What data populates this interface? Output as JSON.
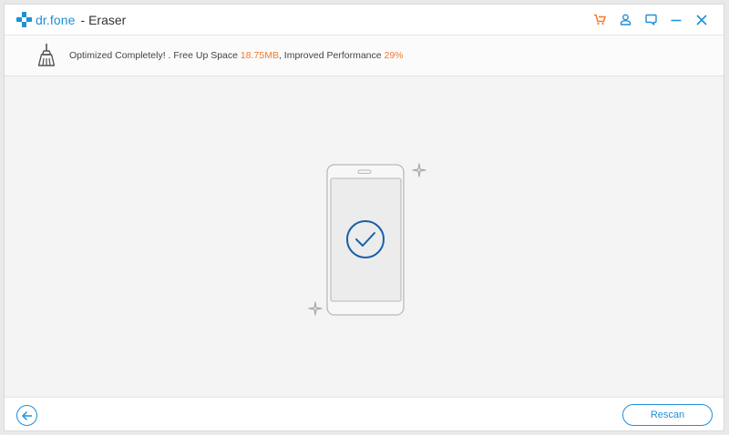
{
  "app": {
    "brand": "dr.fone",
    "module": "- Eraser"
  },
  "titlebar": {
    "icons": [
      "cart-icon",
      "account-icon",
      "feedback-icon",
      "minimize-icon",
      "close-icon"
    ]
  },
  "status": {
    "prefix": "Optimized Completely! . Free Up Space ",
    "space": "18.75MB",
    "middle": ", Improved Performance ",
    "performance": "29%"
  },
  "footer": {
    "rescan_label": "Rescan"
  },
  "colors": {
    "accent": "#1e8fd8",
    "highlight": "#f27c2a"
  }
}
